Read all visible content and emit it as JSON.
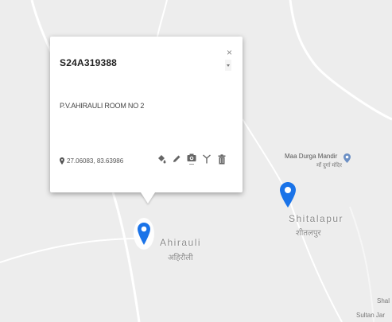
{
  "popup": {
    "title": "S24A319388",
    "subtitle": "P.V.AHIRAULI ROOM NO 2",
    "coordinates": "27.06083, 83.63986",
    "close_symbol": "×",
    "actions": [
      {
        "icon": "paint-bucket-icon"
      },
      {
        "icon": "pencil-icon"
      },
      {
        "icon": "camera-icon"
      },
      {
        "icon": "antenna-icon"
      },
      {
        "icon": "trash-icon"
      }
    ]
  },
  "map": {
    "places": [
      {
        "name": "Ahirauli",
        "name_local": "अहिरौली"
      },
      {
        "name": "Shitalapur",
        "name_local": "शीतलपुर"
      }
    ],
    "poi": {
      "name": "Maa Durga Mandir",
      "name_local": "माँ दुर्गा मंदिर"
    },
    "edge_labels": [
      "Shal",
      "Sultan Jar"
    ],
    "colors": {
      "background": "#ededed",
      "pin": "#1a73e8",
      "road": "#ffffff"
    }
  }
}
